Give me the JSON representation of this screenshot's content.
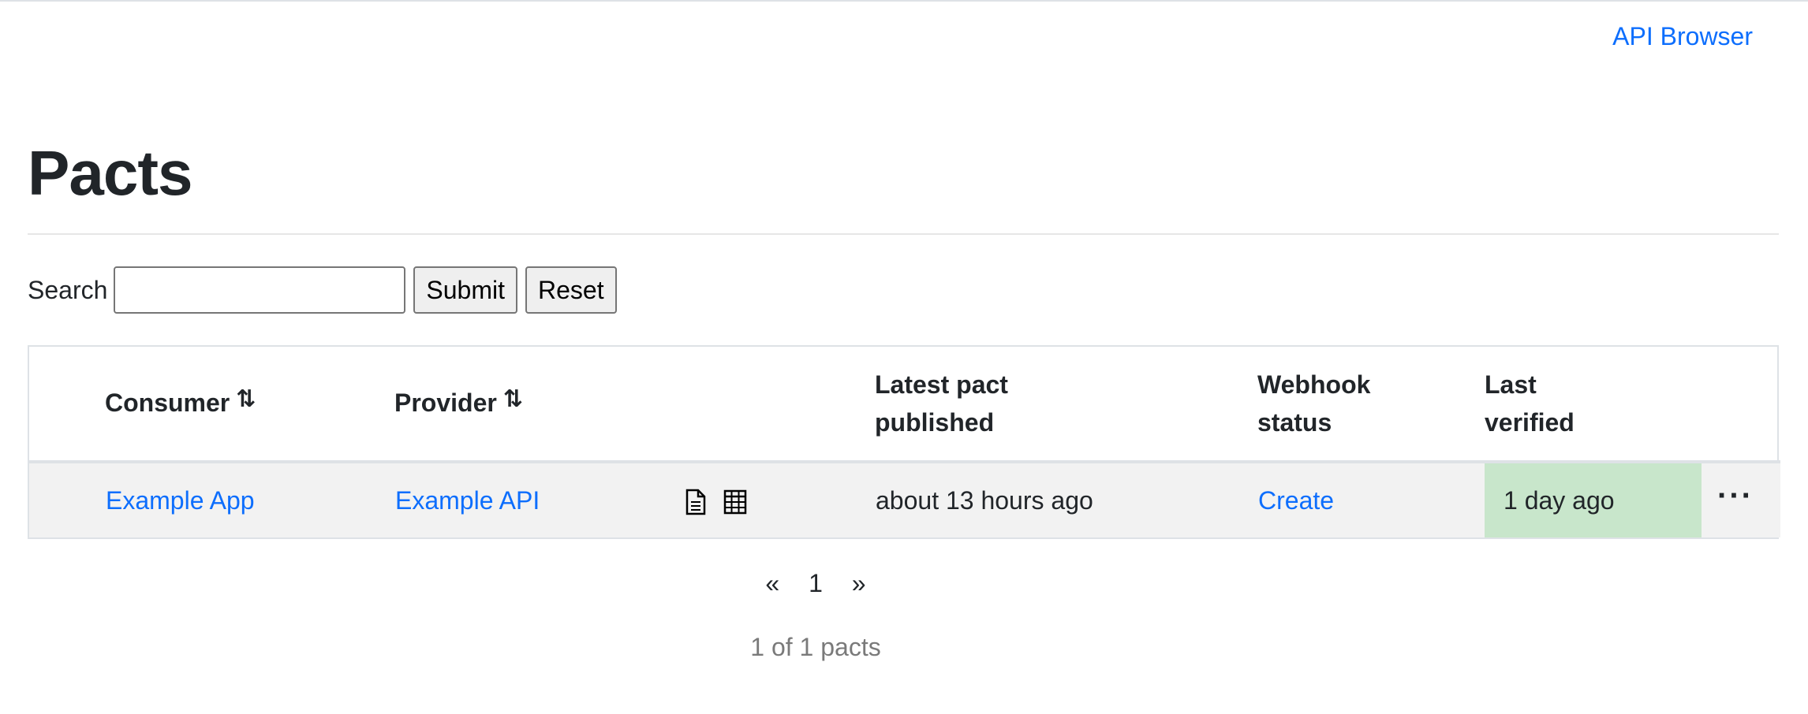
{
  "nav": {
    "api_browser": "API Browser"
  },
  "page": {
    "title": "Pacts"
  },
  "search": {
    "label": "Search",
    "value": "",
    "placeholder": "",
    "submit": "Submit",
    "reset": "Reset"
  },
  "table": {
    "headers": {
      "consumer": "Consumer",
      "provider": "Provider",
      "latest_pact_line1": "Latest pact",
      "latest_pact_line2": "published",
      "webhook_line1": "Webhook",
      "webhook_line2": "status",
      "last_verified_line1": "Last",
      "last_verified_line2": "verified"
    },
    "rows": [
      {
        "consumer": "Example App",
        "provider": "Example API",
        "latest_pact_published": "about 13 hours ago",
        "webhook_status": "Create",
        "last_verified": "1 day ago"
      }
    ]
  },
  "pagination": {
    "prev": "«",
    "page": "1",
    "next": "»"
  },
  "summary": "1 of 1 pacts",
  "colors": {
    "link": "#0d6efd",
    "verified_success": "#c8e6cb",
    "row_bg": "#f2f2f2"
  },
  "icons": {
    "sort": "sort-arrows-icon",
    "document": "document-icon",
    "matrix": "table-grid-icon",
    "more": "more-dots-icon"
  }
}
